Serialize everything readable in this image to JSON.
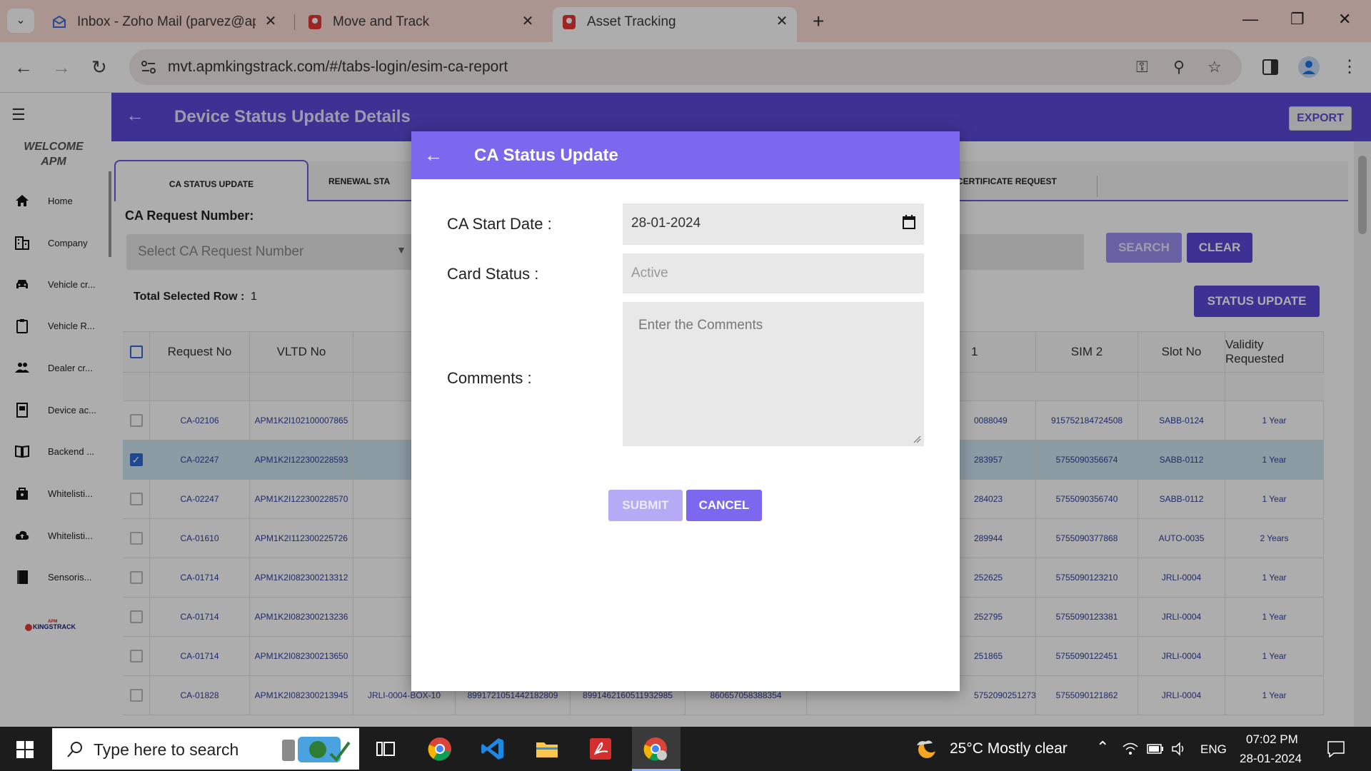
{
  "browser": {
    "tabs": [
      {
        "title": "Inbox - Zoho Mail (parvez@apm",
        "icon": "mail-icon"
      },
      {
        "title": "Move and Track",
        "icon": "location-pin-icon"
      },
      {
        "title": "Asset Tracking",
        "icon": "location-pin-icon",
        "active": true
      }
    ],
    "url": "mvt.apmkingstrack.com/#/tabs-login/esim-ca-report"
  },
  "sidebar": {
    "welcome_line1": "WELCOME",
    "welcome_line2": "APM",
    "items": [
      {
        "label": "Home",
        "icon": "home-icon"
      },
      {
        "label": "Company",
        "icon": "building-icon"
      },
      {
        "label": "Vehicle cr...",
        "icon": "car-icon"
      },
      {
        "label": "Vehicle R...",
        "icon": "clipboard-icon"
      },
      {
        "label": "Dealer cr...",
        "icon": "people-icon"
      },
      {
        "label": "Device ac...",
        "icon": "document-icon"
      },
      {
        "label": "Backend ...",
        "icon": "book-icon"
      },
      {
        "label": "Whitelisti...",
        "icon": "bag-icon"
      },
      {
        "label": "Whitelisti...",
        "icon": "cloud-upload-icon"
      },
      {
        "label": "Sensoris...",
        "icon": "book-dark-icon"
      }
    ],
    "logo_text_top": "APM",
    "logo_text": "KINGSTRACK"
  },
  "header": {
    "title": "Device Status Update Details",
    "export_label": "EXPORT"
  },
  "page_tabs": [
    {
      "label": "CA STATUS UPDATE",
      "active": true
    },
    {
      "label": "RENEWAL STA"
    },
    {
      "label": "CERTIFICATE REQUEST"
    }
  ],
  "filters": {
    "request_label": "CA Request Number:",
    "request_placeholder": "Select CA Request Number",
    "search_label": "SEARCH",
    "clear_label": "CLEAR",
    "total_label": "Total Selected Row :",
    "total_value": "1",
    "status_update_label": "STATUS UPDATE"
  },
  "table": {
    "headers": [
      "Request No",
      "VLTD No",
      "1",
      "SIM 2",
      "Slot No",
      "Validity Requested"
    ],
    "rows": [
      {
        "checked": false,
        "request_no": "CA-02106",
        "vltd_no": "APM1K2I102100007865",
        "sim1": "0088049",
        "sim2": "915752184724508",
        "slot_no": "SABB-0124",
        "validity": "1 Year"
      },
      {
        "checked": true,
        "request_no": "CA-02247",
        "vltd_no": "APM1K2I122300228593",
        "sim1": "283957",
        "sim2": "5755090356674",
        "slot_no": "SABB-0112",
        "validity": "1 Year"
      },
      {
        "checked": false,
        "request_no": "CA-02247",
        "vltd_no": "APM1K2I122300228570",
        "sim1": "284023",
        "sim2": "5755090356740",
        "slot_no": "SABB-0112",
        "validity": "1 Year"
      },
      {
        "checked": false,
        "request_no": "CA-01610",
        "vltd_no": "APM1K2I112300225726",
        "sim1": "289944",
        "sim2": "5755090377868",
        "slot_no": "AUTO-0035",
        "validity": "2 Years"
      },
      {
        "checked": false,
        "request_no": "CA-01714",
        "vltd_no": "APM1K2I082300213312",
        "sim1": "252625",
        "sim2": "5755090123210",
        "slot_no": "JRLI-0004",
        "validity": "1 Year"
      },
      {
        "checked": false,
        "request_no": "CA-01714",
        "vltd_no": "APM1K2I082300213236",
        "sim1": "252795",
        "sim2": "5755090123381",
        "slot_no": "JRLI-0004",
        "validity": "1 Year"
      },
      {
        "checked": false,
        "request_no": "CA-01714",
        "vltd_no": "APM1K2I082300213650",
        "sim1": "251865",
        "sim2": "5755090122451",
        "slot_no": "JRLI-0004",
        "validity": "1 Year"
      },
      {
        "checked": false,
        "request_no": "CA-01828",
        "vltd_no": "APM1K2I082300213945",
        "extra1": "JRLI-0004-BOX-10",
        "extra2": "8991721051442182809",
        "extra3": "8991462160511932985",
        "extra4": "860657058388354",
        "sim1": "5752090251273",
        "sim2": "5755090121862",
        "slot_no": "JRLI-0004",
        "validity": "1 Year"
      }
    ]
  },
  "dialog": {
    "title": "CA Status Update",
    "start_date_label": "CA Start Date :",
    "start_date_value": "28-01-2024",
    "card_status_label": "Card Status :",
    "card_status_value": "Active",
    "comments_label": "Comments :",
    "comments_placeholder": "Enter the Comments",
    "submit_label": "SUBMIT",
    "cancel_label": "CANCEL"
  },
  "taskbar": {
    "search_placeholder": "Type here to search",
    "weather": "25°C  Mostly clear",
    "language": "ENG",
    "time": "07:02 PM",
    "date": "28-01-2024"
  }
}
